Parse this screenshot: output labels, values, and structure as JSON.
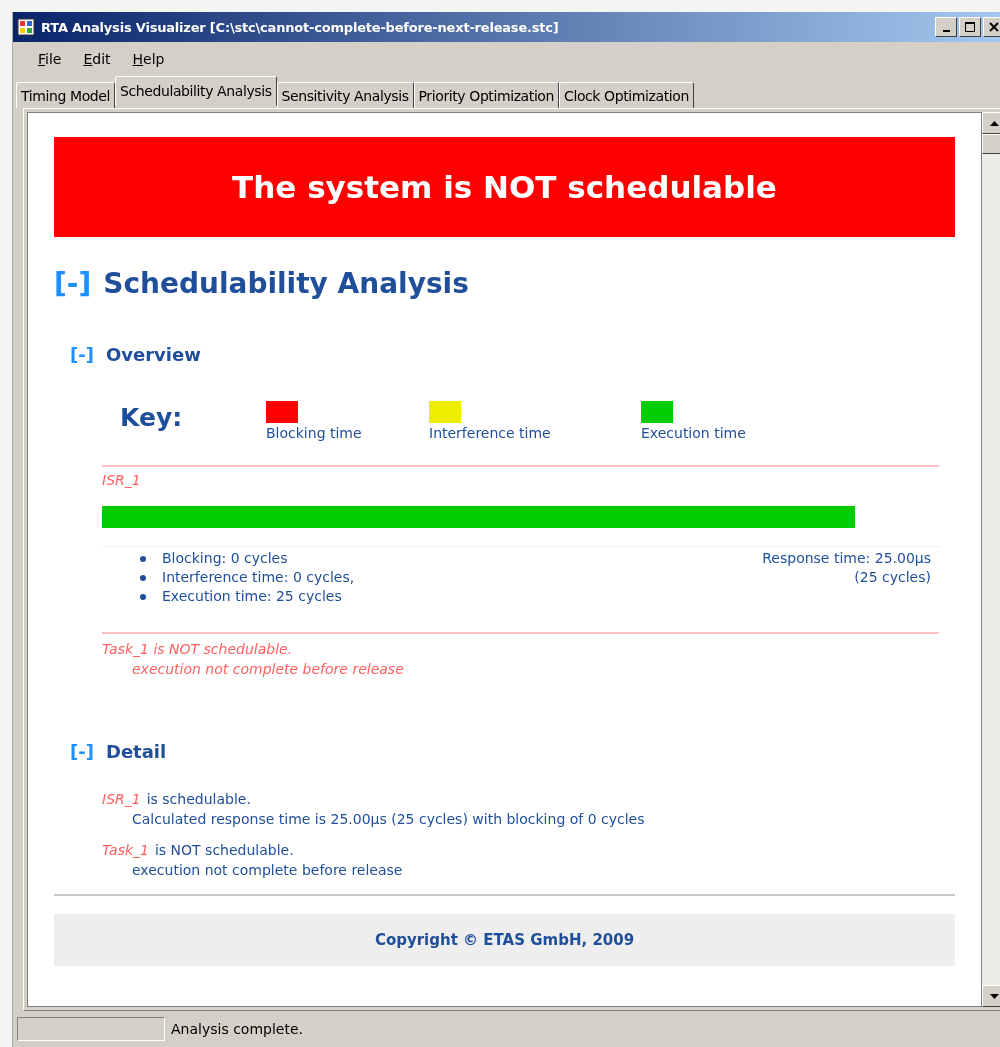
{
  "window": {
    "title": "RTA Analysis Visualizer [C:\\stc\\cannot-complete-before-next-release.stc]"
  },
  "menu": [
    "File",
    "Edit",
    "Help"
  ],
  "tabs": [
    {
      "label": "Timing Model",
      "selected": false
    },
    {
      "label": "Schedulability Analysis",
      "selected": true
    },
    {
      "label": "Sensitivity Analysis",
      "selected": false
    },
    {
      "label": "Priority Optimization",
      "selected": false
    },
    {
      "label": "Clock Optimization",
      "selected": false
    }
  ],
  "banner": {
    "text": "The system is NOT schedulable",
    "schedulable": false
  },
  "section": {
    "toggle": "[-]",
    "title": "Schedulability Analysis"
  },
  "overview": {
    "toggle": "[-]",
    "title": "Overview",
    "key_label": "Key:",
    "key": [
      {
        "label": "Blocking time",
        "color": "#ff0000"
      },
      {
        "label": "Interference time",
        "color": "#eeee00"
      },
      {
        "label": "Execution time",
        "color": "#00cc00"
      }
    ],
    "task": {
      "name": "ISR_1",
      "segments": [
        {
          "kind": "execution",
          "level": 0.9,
          "color": "#00cc00"
        }
      ],
      "stats": [
        "Blocking: 0 cycles",
        "Interference time: 0 cycles,",
        "Execution time: 25 cycles"
      ],
      "response": [
        "Response time: 25.00µs",
        "(25 cycles)"
      ]
    },
    "failure": {
      "title": "Task_1 is NOT schedulable.",
      "reason": "execution not complete before release"
    }
  },
  "detail": {
    "toggle": "[-]",
    "title": "Detail",
    "items": [
      {
        "task": "ISR_1",
        "status": "is schedulable.",
        "note": "Calculated response time is 25.00µs (25 cycles) with blocking of 0 cycles"
      },
      {
        "task": "Task_1",
        "status": "is NOT schedulable.",
        "note": "execution not complete before release"
      }
    ]
  },
  "footer": "Copyright © ETAS GmbH, 2009",
  "status_bar": {
    "text": "Analysis complete."
  }
}
